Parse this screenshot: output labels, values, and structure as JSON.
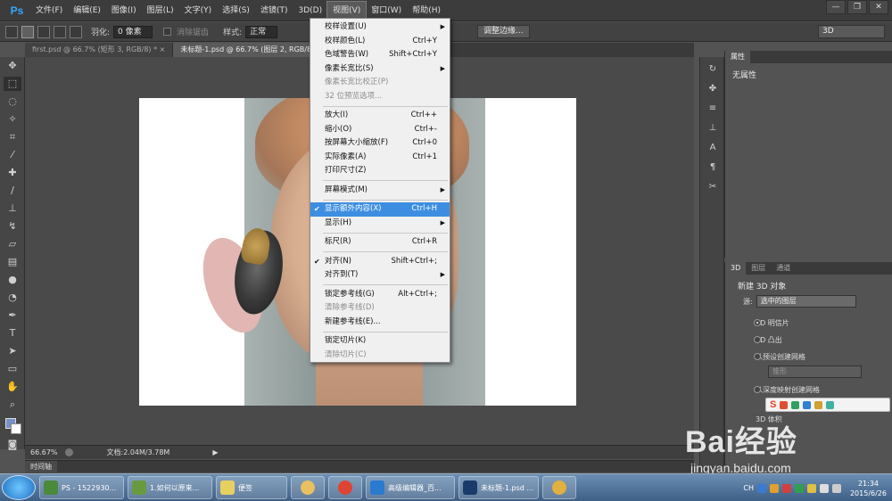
{
  "app": {
    "logo": "Ps"
  },
  "menubar": {
    "items": [
      "文件(F)",
      "编辑(E)",
      "图像(I)",
      "图层(L)",
      "文字(Y)",
      "选择(S)",
      "滤镜(T)",
      "3D(D)",
      "视图(V)",
      "窗口(W)",
      "帮助(H)"
    ],
    "active_index": 8
  },
  "window_controls": {
    "minimize": "—",
    "restore": "❐",
    "close": "✕"
  },
  "options_bar": {
    "feather_label": "羽化:",
    "feather_value": "0 像素",
    "antialias_label": "消除锯齿",
    "style_label": "样式:",
    "style_value": "正常",
    "refine_edge_button": "调整边缘...",
    "workspace": "3D"
  },
  "tabs": [
    {
      "label": "first.psd @ 66.7% (矩形 3, RGB/8) *",
      "close": "×",
      "active": false
    },
    {
      "label": "未标题-1.psd @ 66.7% (图层 2, RGB/8) *",
      "close": "×",
      "active": true
    }
  ],
  "status": {
    "zoom": "66.67%",
    "doc_info": "文档:2.04M/3.78M"
  },
  "timeline_tab": "时间轴",
  "properties_panel": {
    "tab": "属性",
    "empty_text": "无属性"
  },
  "panel3d": {
    "tabs": [
      "3D",
      "图层",
      "通道"
    ],
    "title": "新建 3D 对象",
    "source_label": "源:",
    "source_value": "选中的图层",
    "options": [
      "3D 明信片",
      "3D 凸出",
      "从预设创建网格",
      "从深度映射创建网格"
    ],
    "selected_option": 0,
    "preset_value": "锥形",
    "volume_label": "3D 体积"
  },
  "view_menu": {
    "groups": [
      [
        {
          "label": "校样设置(U)",
          "shortcut": "",
          "submenu": true,
          "disabled": false
        },
        {
          "label": "校样颜色(L)",
          "shortcut": "Ctrl+Y",
          "submenu": false,
          "disabled": false
        },
        {
          "label": "色域警告(W)",
          "shortcut": "Shift+Ctrl+Y",
          "submenu": false,
          "disabled": false
        },
        {
          "label": "像素长宽比(S)",
          "shortcut": "",
          "submenu": true,
          "disabled": false
        },
        {
          "label": "像素长宽比校正(P)",
          "shortcut": "",
          "submenu": false,
          "disabled": true
        },
        {
          "label": "32 位预览选项...",
          "shortcut": "",
          "submenu": false,
          "disabled": true
        }
      ],
      [
        {
          "label": "放大(I)",
          "shortcut": "Ctrl++",
          "submenu": false,
          "disabled": false
        },
        {
          "label": "缩小(O)",
          "shortcut": "Ctrl+-",
          "submenu": false,
          "disabled": false
        },
        {
          "label": "按屏幕大小缩放(F)",
          "shortcut": "Ctrl+0",
          "submenu": false,
          "disabled": false
        },
        {
          "label": "实际像素(A)",
          "shortcut": "Ctrl+1",
          "submenu": false,
          "disabled": false
        },
        {
          "label": "打印尺寸(Z)",
          "shortcut": "",
          "submenu": false,
          "disabled": false
        }
      ],
      [
        {
          "label": "屏幕模式(M)",
          "shortcut": "",
          "submenu": true,
          "disabled": false
        }
      ],
      [
        {
          "label": "显示额外内容(X)",
          "shortcut": "Ctrl+H",
          "submenu": false,
          "disabled": false,
          "checked": true,
          "highlighted": true
        },
        {
          "label": "显示(H)",
          "shortcut": "",
          "submenu": true,
          "disabled": false
        }
      ],
      [
        {
          "label": "标尺(R)",
          "shortcut": "Ctrl+R",
          "submenu": false,
          "disabled": false
        }
      ],
      [
        {
          "label": "对齐(N)",
          "shortcut": "Shift+Ctrl+;",
          "submenu": false,
          "disabled": false,
          "checked": true
        },
        {
          "label": "对齐到(T)",
          "shortcut": "",
          "submenu": true,
          "disabled": false
        }
      ],
      [
        {
          "label": "锁定参考线(G)",
          "shortcut": "Alt+Ctrl+;",
          "submenu": false,
          "disabled": false
        },
        {
          "label": "清除参考线(D)",
          "shortcut": "",
          "submenu": false,
          "disabled": true
        },
        {
          "label": "新建参考线(E)...",
          "shortcut": "",
          "submenu": false,
          "disabled": false
        }
      ],
      [
        {
          "label": "锁定切片(K)",
          "shortcut": "",
          "submenu": false,
          "disabled": false
        },
        {
          "label": "清除切片(C)",
          "shortcut": "",
          "submenu": false,
          "disabled": true
        }
      ]
    ]
  },
  "taskbar": {
    "tasks": [
      {
        "label": "PS - 1522930...",
        "icon_color": "#4a8a3a"
      },
      {
        "label": "1.如何以原来...",
        "icon_color": "#6a9a40"
      },
      {
        "label": "便签",
        "icon_color": "#e8d060"
      },
      {
        "label": "高级编辑器_百...",
        "icon_color": "#2a7ad0"
      },
      {
        "label": "未标题-1.psd ...",
        "icon_color": "#1a3a6a"
      }
    ],
    "lang": "CH",
    "time": "21:34",
    "date": "2015/6/26"
  },
  "watermark": {
    "logo": "Bai经验",
    "url": "jingyan.baidu.com"
  },
  "colors": {
    "accent": "#3d8ee0",
    "ps_blue": "#31a8ff",
    "fg_swatch": "#7890c8",
    "bg_swatch": "#ffffff"
  }
}
